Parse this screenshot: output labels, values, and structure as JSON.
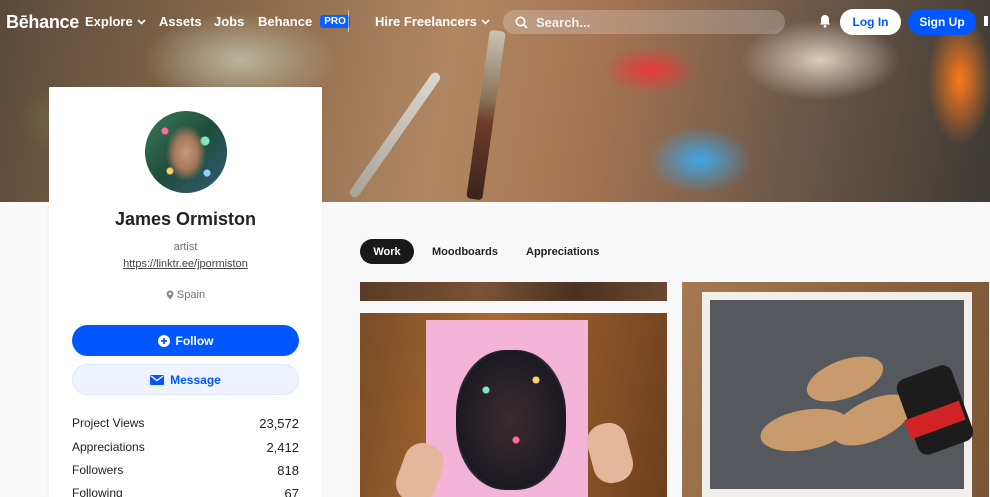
{
  "nav": {
    "logo": "Bēhance",
    "explore": "Explore",
    "assets": "Assets",
    "jobs": "Jobs",
    "behance": "Behance",
    "pro_badge": "PRO",
    "hire": "Hire Freelancers",
    "search_placeholder": "Search...",
    "login": "Log In",
    "signup": "Sign Up"
  },
  "profile": {
    "name": "James Ormiston",
    "occupation": "artist",
    "link": "https://linktr.ee/jpormiston",
    "location": "Spain",
    "follow": "Follow",
    "message": "Message",
    "stats": [
      {
        "label": "Project Views",
        "value": "23,572"
      },
      {
        "label": "Appreciations",
        "value": "2,412"
      },
      {
        "label": "Followers",
        "value": "818"
      },
      {
        "label": "Following",
        "value": "67"
      }
    ]
  },
  "tabs": [
    "Work",
    "Moodboards",
    "Appreciations"
  ],
  "colors": {
    "accent": "#0057ff",
    "active_tab": "#191919"
  },
  "icons": [
    "chevron-down-icon",
    "search-icon",
    "bell-icon",
    "location-pin-icon",
    "plus-circle-icon",
    "mail-icon"
  ]
}
